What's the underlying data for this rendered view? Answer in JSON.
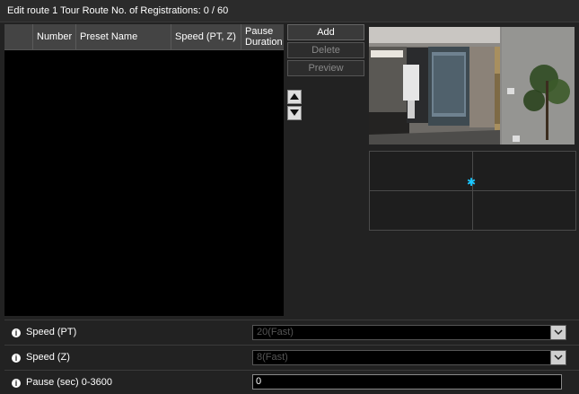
{
  "title": {
    "text": "Edit route 1 Tour Route",
    "registrations": "No. of Registrations: 0 / 60"
  },
  "table": {
    "columns": [
      {
        "key": "select",
        "label": ""
      },
      {
        "key": "number",
        "label": "Number"
      },
      {
        "key": "preset_name",
        "label": "Preset Name"
      },
      {
        "key": "speed",
        "label": "Speed (PT, Z)"
      },
      {
        "key": "pause_duration",
        "label": "Pause Duration"
      }
    ],
    "rows": []
  },
  "buttons": {
    "add": "Add",
    "delete": "Delete",
    "preview": "Preview"
  },
  "icons": {
    "move_up": "up-arrow-icon",
    "move_down": "down-arrow-icon",
    "info": "info-icon",
    "dropdown": "chevron-down-icon",
    "ptz_marker": "crosshair-icon"
  },
  "settings": {
    "speed_pt": {
      "label": "Speed (PT)",
      "value": "20(Fast)"
    },
    "speed_z": {
      "label": "Speed (Z)",
      "value": "8(Fast)"
    },
    "pause": {
      "label": "Pause (sec) 0-3600",
      "value": "0"
    }
  },
  "colors": {
    "background": "#222222",
    "table_bg": "#000000",
    "header_bg": "#444444",
    "marker": "#19c6ff"
  }
}
